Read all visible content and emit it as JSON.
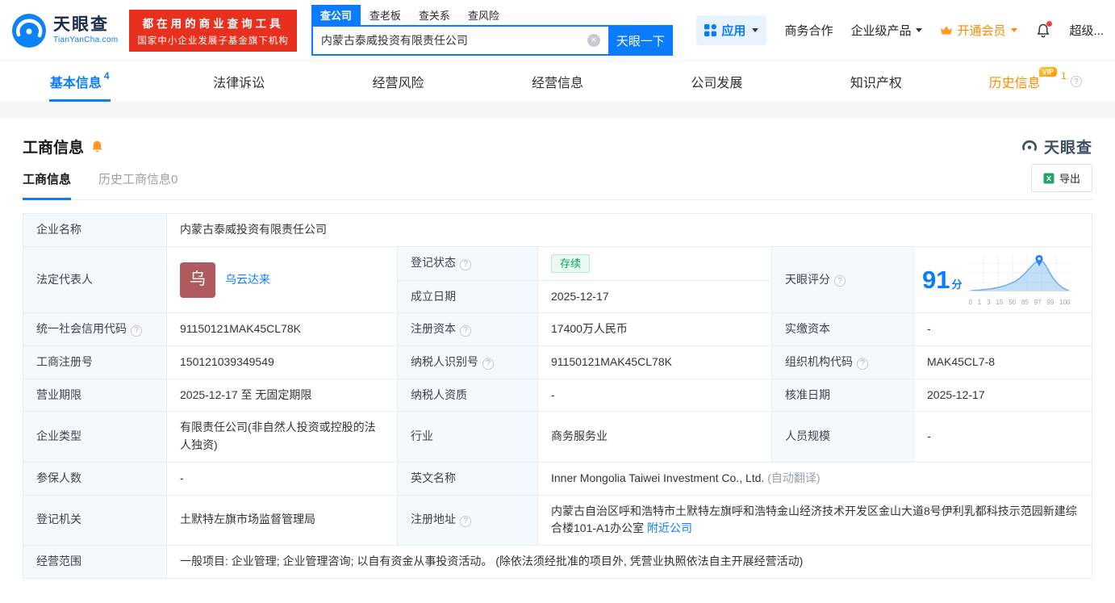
{
  "colors": {
    "accent_blue": "#0b7cff",
    "banner_red": "#e8301e",
    "vip_orange": "#ff8a00",
    "status_green": "#00a860"
  },
  "header": {
    "logo": {
      "brand": "天眼查",
      "domain": "TianYanCha.com"
    },
    "banner": {
      "line1": "都在用的商业查询工具",
      "line2": "国家中小企业发展子基金旗下机构"
    },
    "search": {
      "tabs": [
        {
          "label": "查公司"
        },
        {
          "label": "查老板"
        },
        {
          "label": "查关系"
        },
        {
          "label": "查风险"
        }
      ],
      "value": "内蒙古泰威投资有限责任公司",
      "button": "天眼一下"
    },
    "menu": {
      "apps": "应用",
      "cooperation": "商务合作",
      "enterprise": "企业级产品",
      "vip": "开通会员",
      "super": "超级..."
    }
  },
  "nav": {
    "tabs": [
      {
        "label": "基本信息",
        "count": "4"
      },
      {
        "label": "法律诉讼"
      },
      {
        "label": "经营风险"
      },
      {
        "label": "经营信息"
      },
      {
        "label": "公司发展"
      },
      {
        "label": "知识产权"
      },
      {
        "label": "历史信息",
        "count": "1",
        "badge": "VIP"
      }
    ]
  },
  "section": {
    "title": "工商信息",
    "logo": "天眼查",
    "subtabs": [
      {
        "label": "工商信息"
      },
      {
        "label": "历史工商信息0"
      }
    ],
    "export_label": "导出"
  },
  "table": {
    "company_name": {
      "label": "企业名称",
      "value": "内蒙古泰威投资有限责任公司"
    },
    "legal_rep": {
      "label": "法定代表人",
      "value": "乌云达来",
      "avatar": "乌"
    },
    "reg_status": {
      "label": "登记状态",
      "value": "存续"
    },
    "establish_date": {
      "label": "成立日期",
      "value": "2025-12-17"
    },
    "score": {
      "label": "天眼评分",
      "value": "91",
      "unit": "分",
      "axis": [
        "0",
        "1",
        "3",
        "15",
        "50",
        "85",
        "97",
        "99",
        "100"
      ]
    },
    "credit_code": {
      "label": "统一社会信用代码",
      "value": "91150121MAK45CL78K"
    },
    "reg_capital": {
      "label": "注册资本",
      "value": "17400万人民币"
    },
    "paid_capital": {
      "label": "实缴资本",
      "value": "-"
    },
    "reg_number": {
      "label": "工商注册号",
      "value": "150121039349549"
    },
    "taxpayer_id": {
      "label": "纳税人识别号",
      "value": "91150121MAK45CL78K"
    },
    "org_code": {
      "label": "组织机构代码",
      "value": "MAK45CL7-8"
    },
    "business_term": {
      "label": "营业期限",
      "value": "2025-12-17 至 无固定期限"
    },
    "taxpayer_quality": {
      "label": "纳税人资质",
      "value": "-"
    },
    "approval_date": {
      "label": "核准日期",
      "value": "2025-12-17"
    },
    "company_type": {
      "label": "企业类型",
      "value": "有限责任公司(非自然人投资或控股的法人独资)"
    },
    "industry": {
      "label": "行业",
      "value": "商务服务业"
    },
    "staff_size": {
      "label": "人员规模",
      "value": "-"
    },
    "insured_count": {
      "label": "参保人数",
      "value": "-"
    },
    "english_name": {
      "label": "英文名称",
      "value": "Inner Mongolia Taiwei Investment Co., Ltd.",
      "note": "(自动翻译)"
    },
    "reg_authority": {
      "label": "登记机关",
      "value": "土默特左旗市场监督管理局"
    },
    "reg_address": {
      "label": "注册地址",
      "value": "内蒙古自治区呼和浩特市土默特左旗呼和浩特金山经济技术开发区金山大道8号伊利乳都科技示范园新建综合楼101-A1办公室",
      "link": "附近公司"
    },
    "business_scope": {
      "label": "经营范围",
      "value": "一般项目: 企业管理; 企业管理咨询; 以自有资金从事投资活动。 (除依法须经批准的项目外, 凭营业执照依法自主开展经营活动)"
    }
  }
}
